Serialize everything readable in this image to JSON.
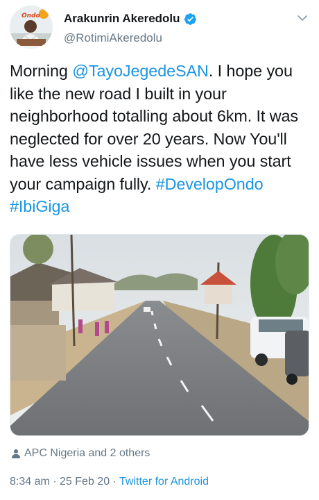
{
  "author": {
    "display_name": "Arakunrin Akeredolu",
    "handle": "@RotimiAkeredolu",
    "avatar_logo_text": "Ondo"
  },
  "tweet": {
    "text_parts": {
      "p1": "Morning ",
      "mention": "@TayoJegedeSAN",
      "p2": ". I hope you like the new road I built in your neighborhood totalling about 6km. It was neglected for over 20 years. Now You'll have less vehicle issues when you start your campaign fully. ",
      "hashtag1": "#DevelopOndo",
      "space": " ",
      "hashtag2": "#IbiGiga"
    }
  },
  "media": {
    "description_icon": "road-photo"
  },
  "engagement": {
    "likes_text": "APC Nigeria and 2 others"
  },
  "meta": {
    "time": "8:34 am",
    "separator1": " · ",
    "date": "25 Feb 20",
    "separator2": " · ",
    "source": "Twitter for Android"
  },
  "colors": {
    "accent": "#1b95e0",
    "secondary_text": "#657786",
    "primary_text": "#14171a"
  },
  "icons": [
    "verified-badge-icon",
    "chevron-down-icon",
    "person-icon"
  ]
}
